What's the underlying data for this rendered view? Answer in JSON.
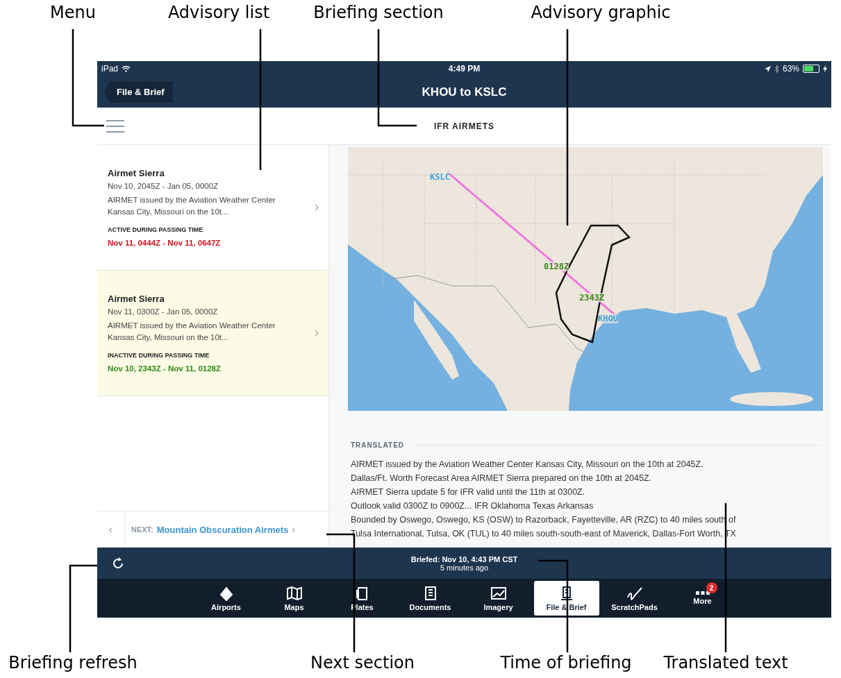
{
  "annotations_top": [
    "Menu",
    "Advisory list",
    "Briefing section",
    "Advisory graphic"
  ],
  "annotations_bottom": [
    "Briefing refresh",
    "Next section",
    "Time of briefing",
    "Translated text"
  ],
  "status_bar": {
    "device": "iPad",
    "time": "4:49 PM",
    "battery_text": "63%",
    "battery": {
      "level": 0.63,
      "charging": true
    }
  },
  "nav_bar": {
    "back_button": "File & Brief",
    "title": "KHOU to KSLC"
  },
  "section_header": {
    "title": "IFR AIRMETS"
  },
  "advisories": [
    {
      "title": "Airmet Sierra",
      "dates": "Nov 10, 2045Z - Jan 05, 0000Z",
      "summary": "AIRMET issued by the Aviation Weather Center Kansas City, Missouri on the 10t...",
      "status_label": "ACTIVE DURING PASSING TIME",
      "status_window": "Nov 11, 0444Z - Nov 11, 0647Z",
      "active": true,
      "selected": false
    },
    {
      "title": "Airmet Sierra",
      "dates": "Nov 11, 0300Z - Jan 05, 0000Z",
      "summary": "AIRMET issued by the Aviation Weather Center Kansas City, Missouri on the 10t...",
      "status_label": "INACTIVE DURING PASSING TIME",
      "status_window": "Nov 10, 2343Z - Nov 11, 0128Z",
      "active": false,
      "selected": true
    }
  ],
  "next_bar": {
    "prev": "‹",
    "label": "NEXT:",
    "link": "Mountain Obscuration Airmets",
    "chevron": "›"
  },
  "map_markers": [
    {
      "label": "KSLC",
      "kind": "airport"
    },
    {
      "label": "0128Z",
      "kind": "time"
    },
    {
      "label": "2343Z",
      "kind": "time"
    },
    {
      "label": "KHOU",
      "kind": "airport"
    }
  ],
  "translated": {
    "heading": "TRANSLATED",
    "lines": [
      "AIRMET issued by the Aviation Weather Center Kansas City, Missouri on the 10th at 2045Z.",
      "Dallas/Ft. Worth Forecast Area AIRMET Sierra prepared on the 10th at 2045Z.",
      "AIRMET Sierra update 5 for IFR valid until the 11th at 0300Z.",
      "Outlook valid 0300Z to 0900Z... IFR Oklahoma Texas Arkansas",
      "Bounded by Oswego, Oswego, KS (OSW) to Razorback, Fayetteville, AR (RZC) to 40 miles south of",
      "Tulsa International, Tulsa, OK (TUL) to 40 miles south-south-east of Maverick, Dallas-Fort Worth, TX"
    ]
  },
  "briefing_bar": {
    "briefed": "Briefed: Nov 10, 4:43 PM CST",
    "ago": "5 minutes ago"
  },
  "tabs": [
    {
      "label": "Airports",
      "selected": false
    },
    {
      "label": "Maps",
      "selected": false
    },
    {
      "label": "Plates",
      "selected": false
    },
    {
      "label": "Documents",
      "selected": false
    },
    {
      "label": "Imagery",
      "selected": false
    },
    {
      "label": "File & Brief",
      "selected": true
    },
    {
      "label": "ScratchPads",
      "selected": false
    },
    {
      "label": "More",
      "selected": false,
      "badge": "2"
    }
  ]
}
